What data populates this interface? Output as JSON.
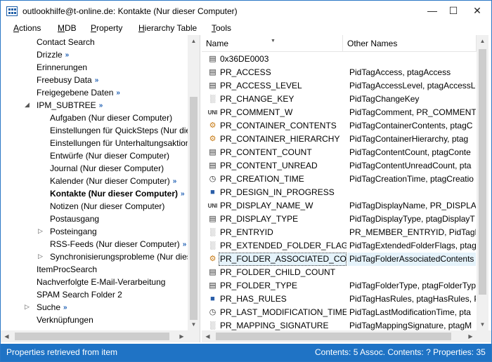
{
  "title": "outlookhilfe@t-online.de: Kontakte (Nur dieser Computer)",
  "menu": [
    {
      "label": "Actions",
      "hotkey": "A",
      "rest": "ctions"
    },
    {
      "label": "MDB",
      "hotkey": "M",
      "rest": "DB"
    },
    {
      "label": "Property",
      "hotkey": "P",
      "rest": "roperty"
    },
    {
      "label": "Hierarchy Table",
      "hotkey": "H",
      "rest": "ierarchy Table"
    },
    {
      "label": "Tools",
      "hotkey": "T",
      "rest": "ools"
    }
  ],
  "window_buttons": {
    "minimize": "—",
    "maximize": "☐",
    "close": "✕"
  },
  "tree": [
    {
      "label": "Contact Search"
    },
    {
      "label": "Drizzle",
      "badge": "»"
    },
    {
      "label": "Erinnerungen"
    },
    {
      "label": "Freebusy Data",
      "badge": "»"
    },
    {
      "label": "Freigegebene Daten",
      "badge": "»"
    },
    {
      "label": "IPM_SUBTREE",
      "badge": "»",
      "expander": "◢"
    },
    {
      "label": "Aufgaben (Nur dieser Computer)"
    },
    {
      "label": "Einstellungen für QuickSteps (Nur die"
    },
    {
      "label": "Einstellungen für Unterhaltungsaktion"
    },
    {
      "label": "Entwürfe (Nur dieser Computer)"
    },
    {
      "label": "Journal (Nur dieser Computer)"
    },
    {
      "label": "Kalender (Nur dieser Computer)",
      "badge": "»"
    },
    {
      "label": "Kontakte (Nur dieser Computer)",
      "badge": "»",
      "bold": true
    },
    {
      "label": "Notizen (Nur dieser Computer)"
    },
    {
      "label": "Postausgang"
    },
    {
      "label": "Posteingang",
      "expander": "▷"
    },
    {
      "label": "RSS-Feeds (Nur dieser Computer)",
      "badge": "»"
    },
    {
      "label": "Synchronisierungsprobleme (Nur dies",
      "expander": "▷"
    },
    {
      "label": "ItemProcSearch"
    },
    {
      "label": "Nachverfolgte E-Mail-Verarbeitung"
    },
    {
      "label": "SPAM Search Folder 2"
    },
    {
      "label": "Suche",
      "badge": "»",
      "expander": "▷"
    },
    {
      "label": "Verknüpfungen"
    }
  ],
  "columns": {
    "name": "Name",
    "other": "Other Names"
  },
  "properties": [
    {
      "icon": "binary-icon",
      "glyph": "▤",
      "name": "0x36DE0003",
      "other": ""
    },
    {
      "icon": "binary-icon",
      "glyph": "▤",
      "name": "PR_ACCESS",
      "other": "PidTagAccess, ptagAccess"
    },
    {
      "icon": "binary-icon",
      "glyph": "▤",
      "name": "PR_ACCESS_LEVEL",
      "other": "PidTagAccessLevel, ptagAccessLe"
    },
    {
      "icon": "bytes-icon",
      "glyph": "░",
      "name": "PR_CHANGE_KEY",
      "other": "PidTagChangeKey"
    },
    {
      "icon": "unicode-icon",
      "glyph": "UNI",
      "name": "PR_COMMENT_W",
      "other": "PidTagComment, PR_COMMENT"
    },
    {
      "icon": "object-icon",
      "glyph": "⚙",
      "name": "PR_CONTAINER_CONTENTS",
      "other": "PidTagContainerContents, ptagC"
    },
    {
      "icon": "object-icon",
      "glyph": "⚙",
      "name": "PR_CONTAINER_HIERARCHY",
      "other": "PidTagContainerHierarchy, ptag"
    },
    {
      "icon": "binary-icon",
      "glyph": "▤",
      "name": "PR_CONTENT_COUNT",
      "other": "PidTagContentCount, ptagConte"
    },
    {
      "icon": "binary-icon",
      "glyph": "▤",
      "name": "PR_CONTENT_UNREAD",
      "other": "PidTagContentUnreadCount, pta"
    },
    {
      "icon": "clock-icon",
      "glyph": "◷",
      "name": "PR_CREATION_TIME",
      "other": "PidTagCreationTime, ptagCreatio"
    },
    {
      "icon": "boolean-icon",
      "glyph": "■",
      "name": "PR_DESIGN_IN_PROGRESS",
      "other": ""
    },
    {
      "icon": "unicode-icon",
      "glyph": "UNI",
      "name": "PR_DISPLAY_NAME_W",
      "other": "PidTagDisplayName, PR_DISPLAY"
    },
    {
      "icon": "binary-icon",
      "glyph": "▤",
      "name": "PR_DISPLAY_TYPE",
      "other": "PidTagDisplayType, ptagDisplayT"
    },
    {
      "icon": "bytes-icon",
      "glyph": "░",
      "name": "PR_ENTRYID",
      "other": "PR_MEMBER_ENTRYID, PidTagEnt"
    },
    {
      "icon": "bytes-icon",
      "glyph": "░",
      "name": "PR_EXTENDED_FOLDER_FLAGS",
      "other": "PidTagExtendedFolderFlags, ptag"
    },
    {
      "icon": "object-icon",
      "glyph": "⚙",
      "name": "PR_FOLDER_ASSOCIATED_CON...",
      "other": "PidTagFolderAssociatedContents",
      "selected": true
    },
    {
      "icon": "binary-icon",
      "glyph": "▤",
      "name": "PR_FOLDER_CHILD_COUNT",
      "other": ""
    },
    {
      "icon": "binary-icon",
      "glyph": "▤",
      "name": "PR_FOLDER_TYPE",
      "other": "PidTagFolderType, ptagFolderTyp"
    },
    {
      "icon": "boolean-icon",
      "glyph": "■",
      "name": "PR_HAS_RULES",
      "other": "PidTagHasRules, ptagHasRules, P"
    },
    {
      "icon": "clock-icon",
      "glyph": "◷",
      "name": "PR_LAST_MODIFICATION_TIME",
      "other": "PidTagLastModificationTime, pta"
    },
    {
      "icon": "bytes-icon",
      "glyph": "░",
      "name": "PR_MAPPING_SIGNATURE",
      "other": "PidTagMappingSignature, ptagM"
    }
  ],
  "status": {
    "left": "Properties retrieved from item",
    "right": "Contents: 5 Assoc. Contents: ?  Properties: 35"
  },
  "colors": {
    "accent": "#1f73c5",
    "selection": "#e5f3fb",
    "badge": "#1e5fb3"
  }
}
